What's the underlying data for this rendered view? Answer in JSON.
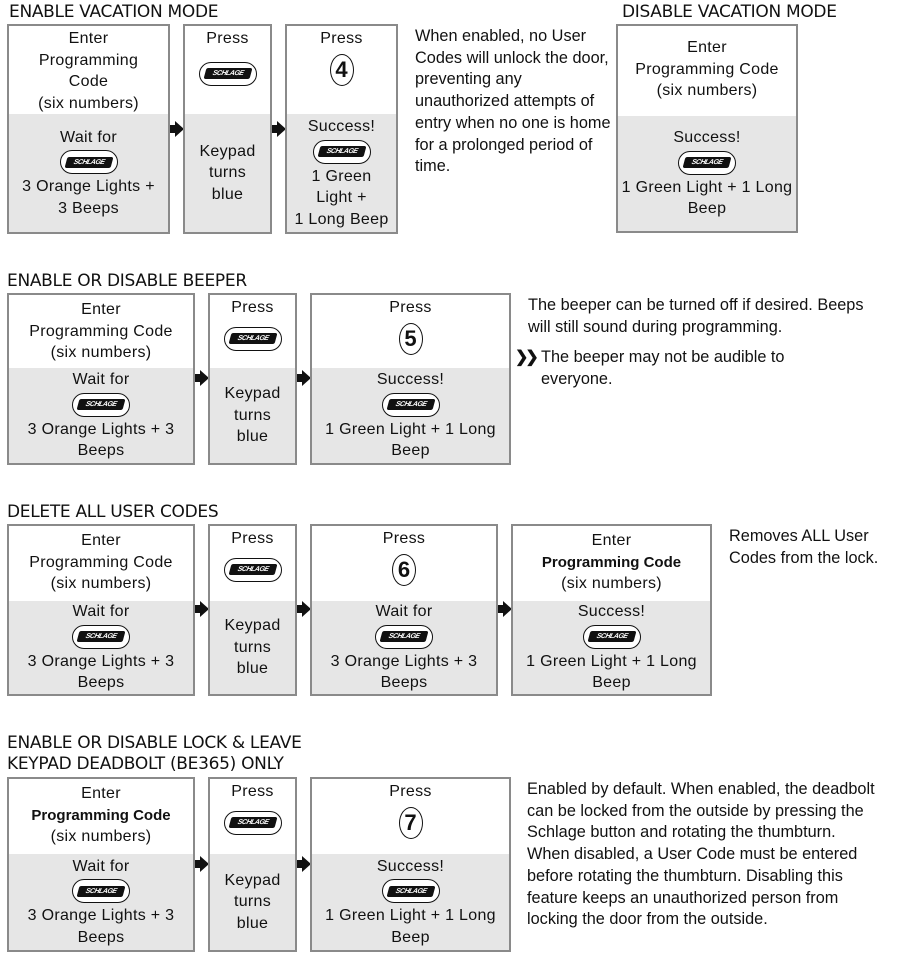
{
  "logo_label": "SCHLAGE",
  "sections": {
    "enable_vacation": {
      "title": "ENABLE VACATION MODE",
      "steps": [
        {
          "top": [
            "Enter",
            "Programming",
            "Code",
            "(six numbers)"
          ],
          "bottom": [
            "Wait for",
            "3 Orange Lights +",
            "3 Beeps"
          ]
        },
        {
          "top": [
            "Press"
          ],
          "bottom": [
            "Keypad",
            "turns",
            "blue"
          ]
        },
        {
          "top": [
            "Press"
          ],
          "key": "4",
          "bottom": [
            "Success!",
            "1 Green",
            "Light +",
            "1 Long Beep"
          ]
        }
      ],
      "description": "When enabled, no User Codes will unlock the door, preventing any unauthorized attempts of entry when no one is home for a prolonged period of time."
    },
    "disable_vacation": {
      "title": "DISABLE VACATION MODE",
      "steps": [
        {
          "top": [
            "Enter",
            "Programming Code",
            "(six numbers)"
          ],
          "bottom": [
            "Success!",
            "1 Green Light + 1 Long",
            "Beep"
          ]
        }
      ]
    },
    "beeper": {
      "title": "ENABLE OR DISABLE BEEPER",
      "steps": [
        {
          "top": [
            "Enter",
            "Programming Code",
            "(six numbers)"
          ],
          "bottom": [
            "Wait for",
            "3 Orange Lights + 3",
            "Beeps"
          ]
        },
        {
          "top": [
            "Press"
          ],
          "bottom": [
            "Keypad",
            "turns",
            "blue"
          ]
        },
        {
          "top": [
            "Press"
          ],
          "key": "5",
          "bottom": [
            "Success!",
            "1 Green Light + 1 Long",
            "Beep"
          ]
        }
      ],
      "description": "The beeper can be turned off if desired. Beeps will still sound during programming.",
      "note": "The beeper may not be audible to everyone."
    },
    "delete_codes": {
      "title": "DELETE ALL USER CODES",
      "steps": [
        {
          "top": [
            "Enter",
            "Programming Code",
            "(six numbers)"
          ],
          "bottom": [
            "Wait for",
            "3 Orange Lights + 3",
            "Beeps"
          ]
        },
        {
          "top": [
            "Press"
          ],
          "bottom": [
            "Keypad",
            "turns",
            "blue"
          ]
        },
        {
          "top": [
            "Press"
          ],
          "key": "6",
          "bottom": [
            "Wait for",
            "3 Orange Lights + 3",
            "Beeps"
          ]
        },
        {
          "top": [
            "Enter",
            "Programming Code",
            "(six numbers)"
          ],
          "bottom": [
            "Success!",
            "1 Green Light + 1 Long",
            "Beep"
          ]
        }
      ],
      "description": "Removes ALL User Codes from the lock."
    },
    "lock_leave": {
      "title": "ENABLE OR DISABLE LOCK & LEAVE",
      "subtitle": "KEYPAD DEADBOLT (BE365) ONLY",
      "steps": [
        {
          "top": [
            "Enter",
            "Programming Code",
            "(six numbers)"
          ],
          "bottom": [
            "Wait for",
            "3 Orange Lights + 3",
            "Beeps"
          ]
        },
        {
          "top": [
            "Press"
          ],
          "bottom": [
            "Keypad",
            "turns",
            "blue"
          ]
        },
        {
          "top": [
            "Press"
          ],
          "key": "7",
          "bottom": [
            "Success!",
            "1 Green Light + 1 Long",
            "Beep"
          ]
        }
      ],
      "description": "Enabled by default. When enabled, the deadbolt can be locked from the outside by pressing the Schlage button and rotating the thumbturn. When disabled, a User Code must be entered before rotating the thumbturn. Disabling this feature keeps an unauthorized person from locking the door from the outside."
    }
  }
}
